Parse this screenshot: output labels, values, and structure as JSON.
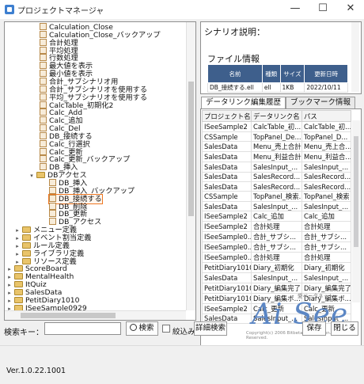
{
  "window": {
    "title": "プロジェクトマネージャ",
    "minimize": "—",
    "maximize": "☐",
    "close": "✕"
  },
  "tree": {
    "items": [
      {
        "label": "Calculation_Close",
        "depth": 3,
        "kind": "doc"
      },
      {
        "label": "Calculation_Close_バックアップ",
        "depth": 3,
        "kind": "doc"
      },
      {
        "label": "合計処理",
        "depth": 3,
        "kind": "doc"
      },
      {
        "label": "平均処理",
        "depth": 3,
        "kind": "doc"
      },
      {
        "label": "行数処理",
        "depth": 3,
        "kind": "doc"
      },
      {
        "label": "最大値を表示",
        "depth": 3,
        "kind": "doc"
      },
      {
        "label": "最小値を表示",
        "depth": 3,
        "kind": "doc"
      },
      {
        "label": "合計_サブシナリオ用",
        "depth": 3,
        "kind": "doc"
      },
      {
        "label": "合計_サブシナリオを使用する",
        "depth": 3,
        "kind": "doc"
      },
      {
        "label": "平均_サブシナリオを使用する",
        "depth": 3,
        "kind": "doc"
      },
      {
        "label": "CalcTable_初期化2",
        "depth": 3,
        "kind": "doc"
      },
      {
        "label": "Calc_Add",
        "depth": 3,
        "kind": "doc"
      },
      {
        "label": "Calc_追加",
        "depth": 3,
        "kind": "doc"
      },
      {
        "label": "Calc_Del",
        "depth": 3,
        "kind": "doc"
      },
      {
        "label": "DB_接続する",
        "depth": 3,
        "kind": "doc"
      },
      {
        "label": "Calc_行選択",
        "depth": 3,
        "kind": "doc"
      },
      {
        "label": "Calc_更新",
        "depth": 3,
        "kind": "doc"
      },
      {
        "label": "Calc_更新_バックアップ",
        "depth": 3,
        "kind": "doc"
      },
      {
        "label": "DB_挿入",
        "depth": 3,
        "kind": "doc"
      },
      {
        "label": "DBアクセス",
        "depth": 2,
        "kind": "folder",
        "toggle": "▾"
      },
      {
        "label": "DB_挿入",
        "depth": 4,
        "kind": "doc"
      },
      {
        "label": "DB_挿入_バックアップ",
        "depth": 4,
        "kind": "doc"
      },
      {
        "label": "DB_接続する",
        "depth": 4,
        "kind": "doc",
        "selected": true
      },
      {
        "label": "DB_削除",
        "depth": 4,
        "kind": "doc"
      },
      {
        "label": "DB_更新",
        "depth": 4,
        "kind": "doc"
      },
      {
        "label": "DB_アクセス",
        "depth": 4,
        "kind": "doc"
      },
      {
        "label": "メニュー定義",
        "depth": 1,
        "kind": "folder",
        "toggle": "▸"
      },
      {
        "label": "イベント割当定義",
        "depth": 1,
        "kind": "folder",
        "toggle": "▸"
      },
      {
        "label": "ルール定義",
        "depth": 1,
        "kind": "folder",
        "toggle": "▸"
      },
      {
        "label": "ライブラリ定義",
        "depth": 1,
        "kind": "folder",
        "toggle": "▸"
      },
      {
        "label": "リソース定義",
        "depth": 1,
        "kind": "folder",
        "toggle": "▸"
      },
      {
        "label": "ScoreBoard",
        "depth": 0,
        "kind": "folder",
        "toggle": "▸"
      },
      {
        "label": "MentalHealth",
        "depth": 0,
        "kind": "folder",
        "toggle": "▸"
      },
      {
        "label": "ItQuiz",
        "depth": 0,
        "kind": "folder",
        "toggle": "▸"
      },
      {
        "label": "SalesData",
        "depth": 0,
        "kind": "folder",
        "toggle": "▸"
      },
      {
        "label": "PetitDiary1010",
        "depth": 0,
        "kind": "folder",
        "toggle": "▸"
      },
      {
        "label": "ISeeSample0929",
        "depth": 0,
        "kind": "folder",
        "toggle": "▸"
      }
    ]
  },
  "scenario": {
    "label": "シナリオ説明："
  },
  "file_info": {
    "label": "ファイル情報",
    "headers": [
      "名前",
      "種類",
      "サイズ",
      "更新日時"
    ],
    "row": [
      "DB_接続する.ell",
      "ell",
      "1KB",
      "2022/10/11"
    ]
  },
  "tabs": {
    "history": "データリンク編集履歴",
    "bookmark": "ブックマーク情報"
  },
  "history": {
    "headers": [
      "プロジェクト名",
      "データリンク名",
      "パス"
    ],
    "rows": [
      [
        "ISeeSample2",
        "CalcTable_初...",
        "CalcTable_初..."
      ],
      [
        "CSSample",
        "TopPanel_De...",
        "TopPanel_D..."
      ],
      [
        "SalesData",
        "Menu_売上合計...",
        "Menu_売上合..."
      ],
      [
        "SalesData",
        "Menu_利益合計...",
        "Menu_利益合..."
      ],
      [
        "SalesData",
        "SalesInput_...",
        "SalesInput_..."
      ],
      [
        "SalesData",
        "SalesRecord...",
        "SalesRecord..."
      ],
      [
        "SalesData",
        "SalesRecord...",
        "SalesRecord..."
      ],
      [
        "CSSample",
        "TopPanel_検索...",
        "TopPanel_検索"
      ],
      [
        "SalesData",
        "SalesInput_...",
        "SalesInput_..."
      ],
      [
        "ISeeSample2",
        "Calc_追加",
        "Calc_追加"
      ],
      [
        "ISeeSample2",
        "合計処理",
        "合計処理"
      ],
      [
        "ISeeSample0...",
        "合計_サブシ...",
        "合計_サブシ..."
      ],
      [
        "ISeeSample0...",
        "合計_サブシ...",
        "合計_サブシ..."
      ],
      [
        "ISeeSample0...",
        "合計処理",
        "合計処理"
      ],
      [
        "PetitDiary1010",
        "Diary_初期化",
        "Diary_初期化"
      ],
      [
        "SalesData",
        "SalesInput_...",
        "SalesInput_..."
      ],
      [
        "PetitDiary1010",
        "Diary_編集完了",
        "Diary_編集完了"
      ],
      [
        "PetitDiary1010",
        "Diary_編集ボ...",
        "Diary_編集ボ..."
      ],
      [
        "ISeeSample2",
        "Calc_更新",
        "Calc_更新"
      ],
      [
        "SalesData",
        "SalesInput_...",
        "SalesInput_..."
      ]
    ]
  },
  "logo": {
    "small": "愛ベータネット",
    "main": "Ai See",
    "copyright": "Copyright(c) 2006 Bitbeta Corporation. All Rights Reserved."
  },
  "search": {
    "label": "検索キー：",
    "value": "",
    "search_button": "検索",
    "narrow_label": "絞込み",
    "detail_button": "詳細検索"
  },
  "actions": {
    "save": "保存",
    "close": "閉じる"
  },
  "version": "Ver.1.0.22.1001"
}
